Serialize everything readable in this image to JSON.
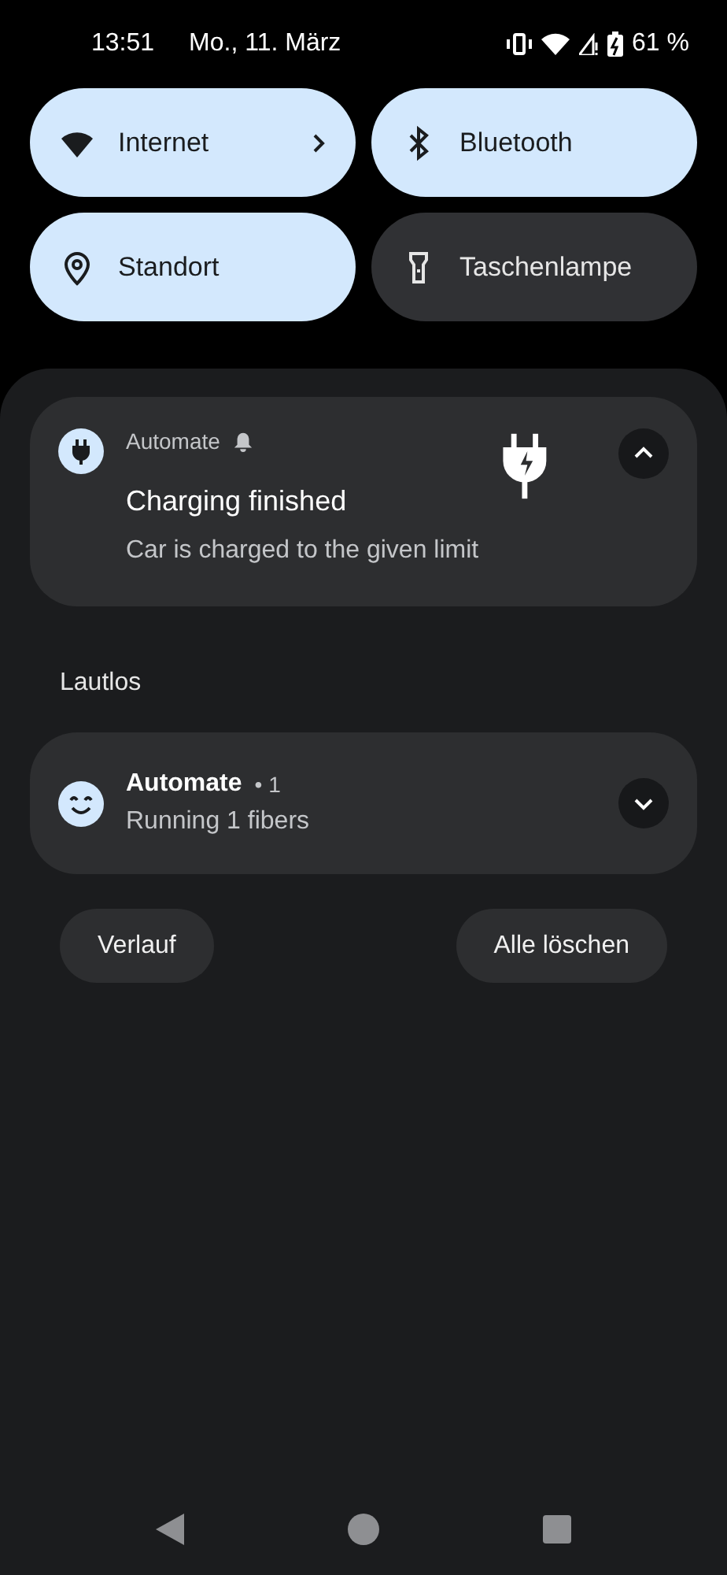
{
  "status_bar": {
    "time": "13:51",
    "date": "Mo., 11. März",
    "battery": "61 %"
  },
  "tiles": [
    {
      "kind": "wifi",
      "label": "Internet",
      "on": true,
      "has_detail": true
    },
    {
      "kind": "bluetooth",
      "label": "Bluetooth",
      "on": true,
      "has_detail": false
    },
    {
      "kind": "location",
      "label": "Standort",
      "on": true,
      "has_detail": false
    },
    {
      "kind": "flashlight",
      "label": "Taschenlampe",
      "on": false,
      "has_detail": false
    }
  ],
  "notifications": [
    {
      "kind": "alerting",
      "app": "Automate",
      "title": "Charging finished",
      "text": "Car is charged to the given limit",
      "expanded": true
    },
    {
      "section": "Lautlos",
      "kind": "silent",
      "app": "Automate",
      "count": "• 1",
      "text": "Running 1 fibers",
      "expanded": false
    }
  ],
  "actions": [
    "Verlauf",
    "Alle löschen"
  ]
}
